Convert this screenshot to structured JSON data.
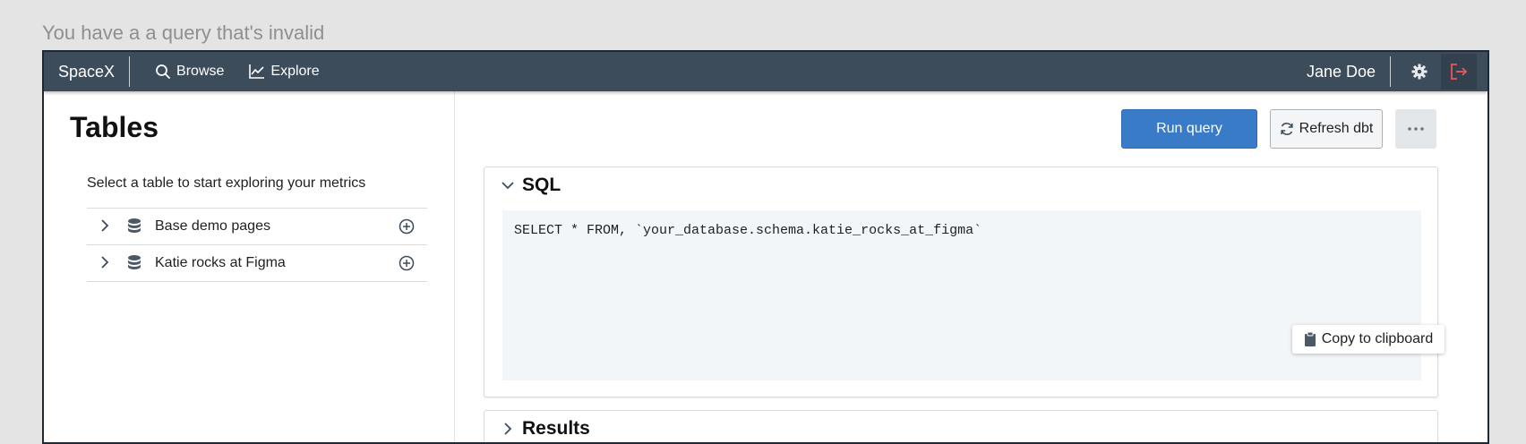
{
  "caption": "You have a a query that's invalid",
  "navbar": {
    "brand": "SpaceX",
    "links": [
      {
        "label": "Browse",
        "icon": "search-icon"
      },
      {
        "label": "Explore",
        "icon": "chart-line-icon"
      }
    ],
    "user_name": "Jane Doe",
    "settings_icon": "gear-icon",
    "logout_icon": "logout-icon",
    "logout_color": "#e8585a"
  },
  "sidebar": {
    "title": "Tables",
    "hint": "Select a table to start exploring your metrics",
    "tables": [
      {
        "label": "Base demo pages"
      },
      {
        "label": "Katie rocks at Figma"
      }
    ]
  },
  "toolbar": {
    "run_label": "Run query",
    "refresh_label": "Refresh dbt",
    "more_icon": "ellipsis-icon",
    "accent": "#3a7bc8"
  },
  "sql_panel": {
    "title": "SQL",
    "code": "SELECT * FROM, `your_database.schema.katie_rocks_at_figma`",
    "copy_label": "Copy to clipboard"
  },
  "results_panel": {
    "title": "Results"
  }
}
